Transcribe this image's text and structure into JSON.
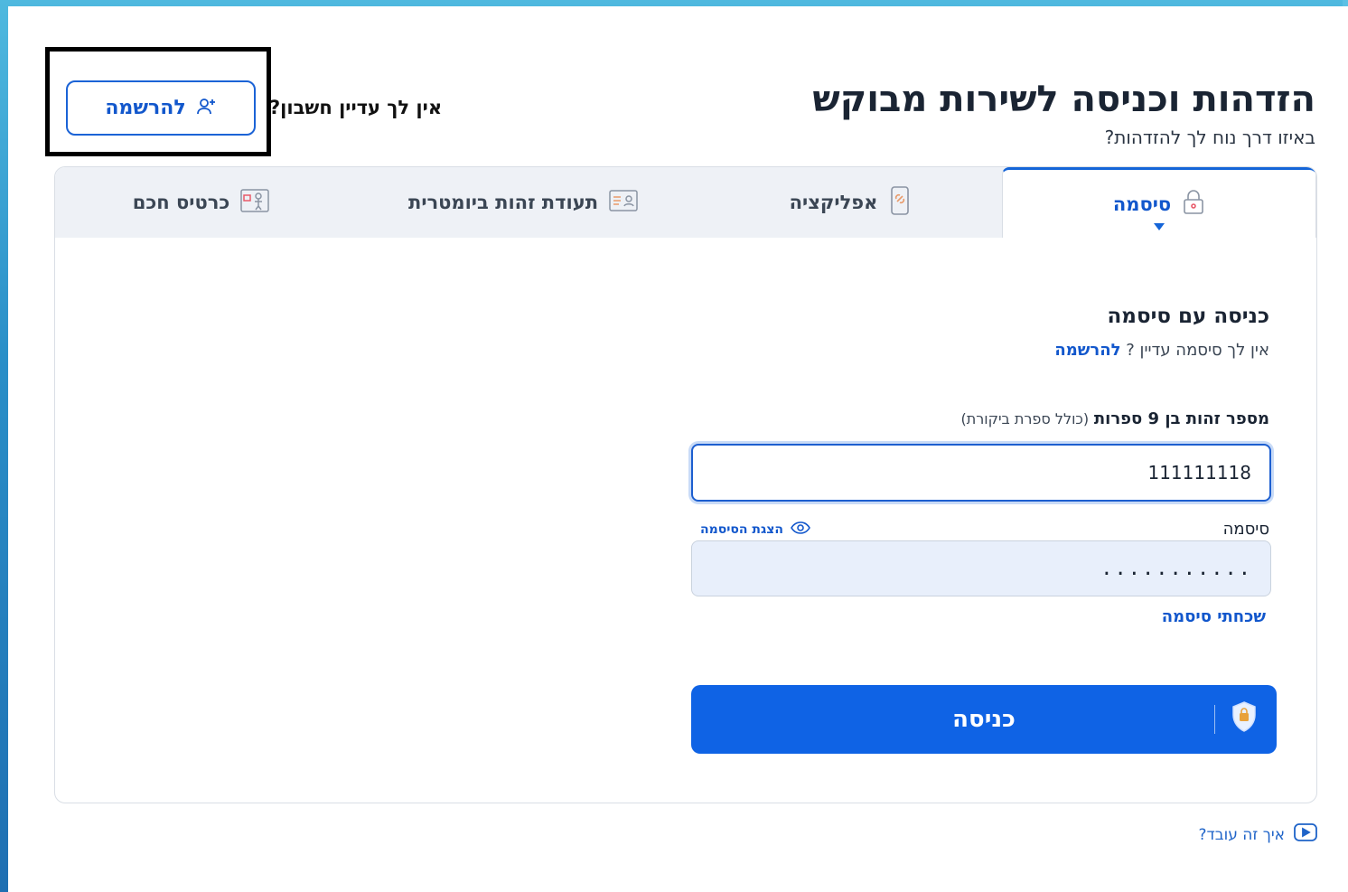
{
  "header": {
    "title": "הזדהות וכניסה לשירות מבוקש",
    "subtitle": "באיזו דרך נוח לך להזדהות?",
    "no_account_text": "אין לך עדיין חשבון?",
    "register_label": "להרשמה"
  },
  "tabs": [
    {
      "label": "סיסמה",
      "icon": "lock-icon",
      "active": true
    },
    {
      "label": "אפליקציה",
      "icon": "phone-link-icon",
      "active": false
    },
    {
      "label": "תעודת זהות ביומטרית",
      "icon": "id-card-icon",
      "active": false
    },
    {
      "label": "כרטיס חכם",
      "icon": "smart-card-icon",
      "active": false
    }
  ],
  "form": {
    "title": "כניסה עם סיסמה",
    "no_password_text": "אין לך סיסמה עדיין ?",
    "register_link": "להרשמה",
    "id_label_bold": "מספר זהות בן 9 ספרות",
    "id_label_note": "(כולל ספרת ביקורת)",
    "id_value": "111111118",
    "password_label": "סיסמה",
    "show_password_label": "הצגת הסיסמה",
    "password_value": "...........",
    "forgot_password": "שכחתי סיסמה",
    "submit_label": "כניסה"
  },
  "footer": {
    "how_it_works": "איך זה עובד?"
  },
  "colors": {
    "primary": "#0f63e5",
    "link": "#1257cc",
    "tab_bg": "#eef1f6",
    "highlight_border": "#000000"
  }
}
